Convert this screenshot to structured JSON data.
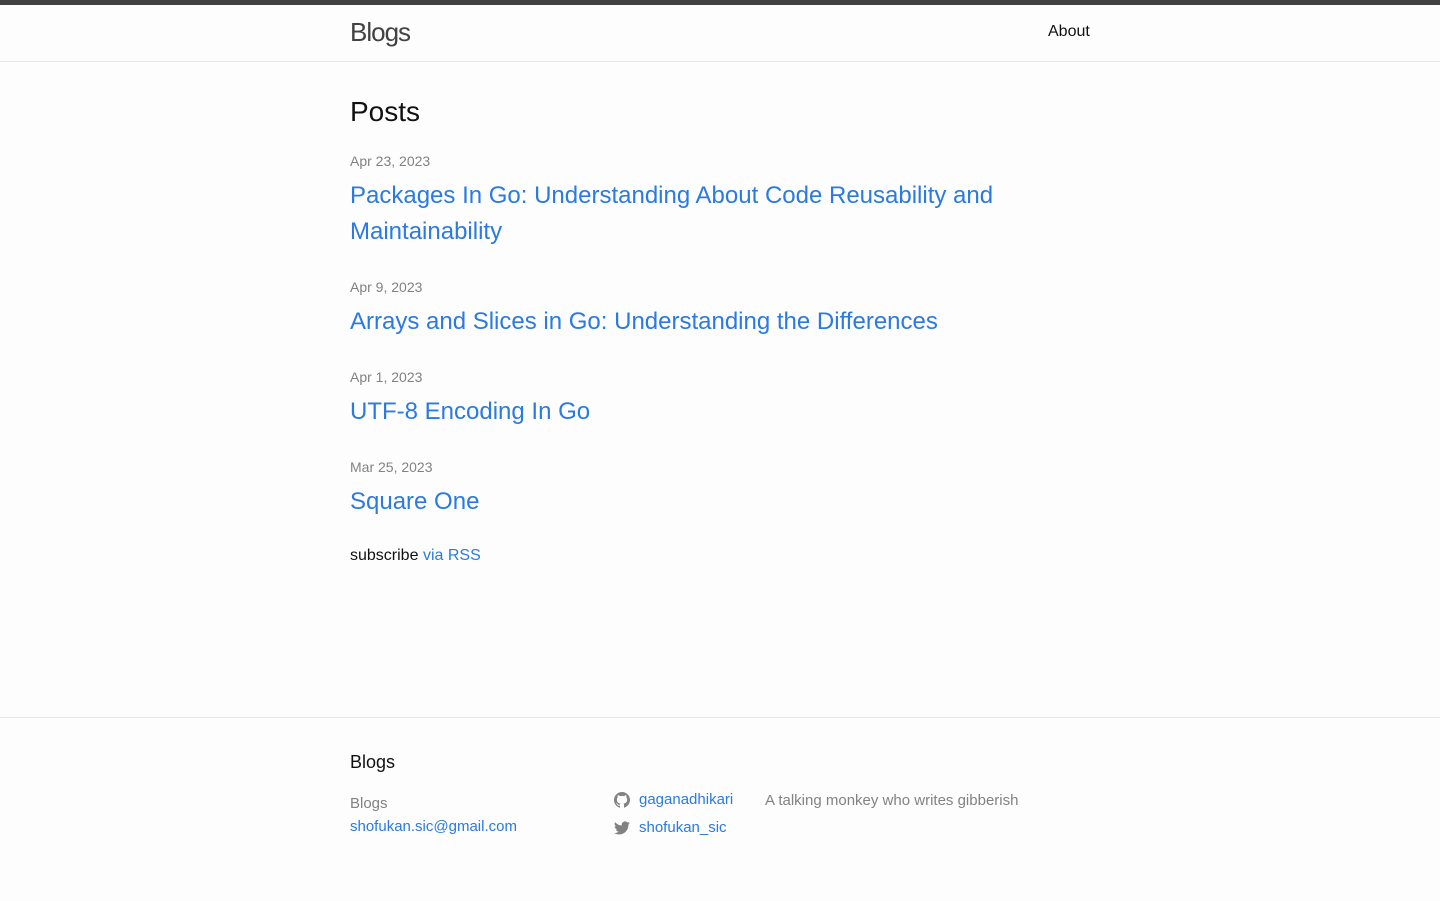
{
  "header": {
    "site_title": "Blogs",
    "nav": [
      {
        "label": "About"
      }
    ]
  },
  "main": {
    "heading": "Posts",
    "posts": [
      {
        "date": "Apr 23, 2023",
        "title": "Packages In Go: Understanding About Code Reusability and Maintainability"
      },
      {
        "date": "Apr 9, 2023",
        "title": "Arrays and Slices in Go: Understanding the Differences"
      },
      {
        "date": "Apr 1, 2023",
        "title": "UTF-8 Encoding In Go"
      },
      {
        "date": "Mar 25, 2023",
        "title": "Square One"
      }
    ],
    "subscribe": {
      "text": "subscribe",
      "link_label": "via RSS"
    }
  },
  "footer": {
    "heading": "Blogs",
    "name": "Blogs",
    "email": "shofukan.sic@gmail.com",
    "social": [
      {
        "icon": "github-icon",
        "label": "gaganadhikari"
      },
      {
        "icon": "twitter-icon",
        "label": "shofukan_sic"
      }
    ],
    "description": "A talking monkey who writes gibberish"
  },
  "colors": {
    "link": "#2a7ae2",
    "meta": "#828282",
    "topbar": "#424242",
    "background": "#fdfdfd"
  }
}
